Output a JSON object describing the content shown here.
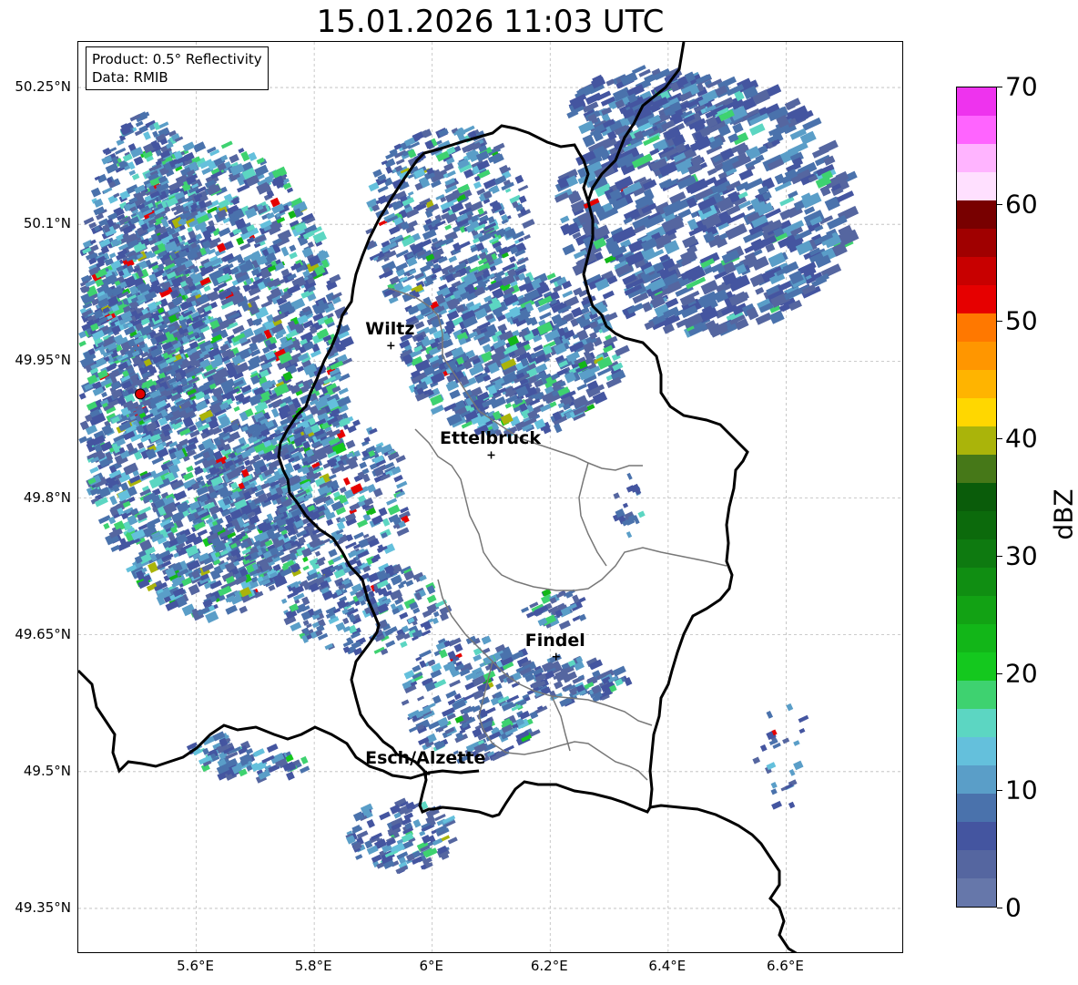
{
  "title": "15.01.2026 11:03 UTC",
  "info": {
    "product": "Product: 0.5° Reflectivity",
    "data_source": "Data: RMIB"
  },
  "axes": {
    "lat_labels": [
      "50.25°N",
      "50.1°N",
      "49.95°N",
      "49.8°N",
      "49.65°N",
      "49.5°N",
      "49.35°N"
    ],
    "lon_labels": [
      "5.6°E",
      "5.8°E",
      "6°E",
      "6.2°E",
      "6.4°E",
      "6.6°E"
    ]
  },
  "cities": [
    {
      "name": "Wiltz",
      "lon": 5.93,
      "lat": 49.967
    },
    {
      "name": "Ettelbruck",
      "lon": 6.1,
      "lat": 49.847
    },
    {
      "name": "Findel",
      "lon": 6.21,
      "lat": 49.626
    },
    {
      "name": "Esch/Alzette",
      "lon": 5.99,
      "lat": 49.497
    }
  ],
  "radar_site": {
    "lon": 5.505,
    "lat": 49.914,
    "color": "#e00000"
  },
  "colorbar": {
    "label": "dBZ",
    "ticks": [
      "0",
      "10",
      "20",
      "30",
      "40",
      "50",
      "60",
      "70"
    ],
    "min": 0,
    "max": 70,
    "colors": [
      "#6677aa",
      "#5566a0",
      "#4455a0",
      "#4a72ac",
      "#5a9ec8",
      "#64c0dc",
      "#5cd6c2",
      "#3ed270",
      "#14c81e",
      "#12b618",
      "#12a214",
      "#108e12",
      "#0e7a10",
      "#0c6a0c",
      "#0a5c0a",
      "#467818",
      "#aab40a",
      "#ffd700",
      "#ffb400",
      "#ff9600",
      "#ff7800",
      "#e60000",
      "#c80000",
      "#a00000",
      "#780000",
      "#ffe0ff",
      "#ffb4ff",
      "#ff64ff",
      "#ee33ee"
    ]
  },
  "map_extent": {
    "lon_min": 5.4,
    "lon_max": 6.8,
    "lat_min": 49.3,
    "lat_max": 50.3
  }
}
